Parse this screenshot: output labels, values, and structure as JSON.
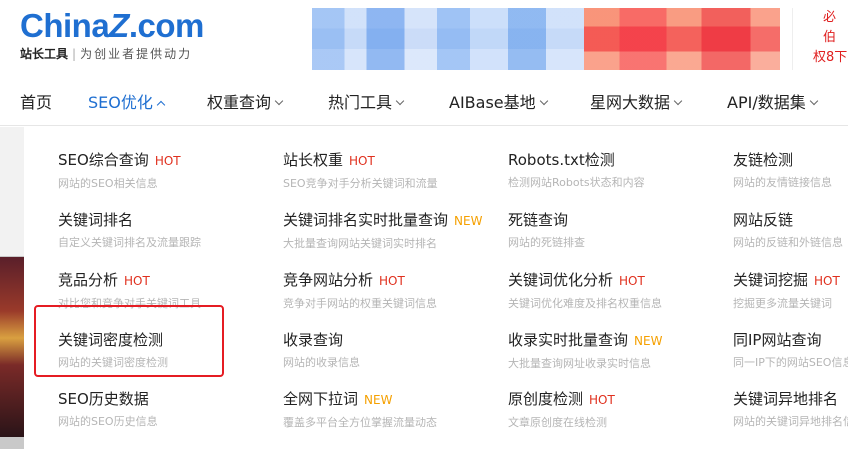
{
  "brand": {
    "logo_text_main": "China",
    "logo_text_z": "Z",
    "logo_text_tail": ".com",
    "sub_title": "站长工具",
    "separator": "|",
    "slogan": "为创业者提供动力",
    "side_note_line1": "必伯",
    "side_note_line2": "权8下"
  },
  "nav": {
    "items": [
      {
        "label": "首页",
        "has_chevron": false,
        "active": false
      },
      {
        "label": "SEO优化",
        "has_chevron": true,
        "active": true
      },
      {
        "label": "权重查询",
        "has_chevron": true,
        "active": false
      },
      {
        "label": "热门工具",
        "has_chevron": true,
        "active": false
      },
      {
        "label": "AIBase基地",
        "has_chevron": true,
        "active": false
      },
      {
        "label": "星网大数据",
        "has_chevron": true,
        "active": false
      },
      {
        "label": "API/数据集",
        "has_chevron": true,
        "active": false
      }
    ]
  },
  "menu": {
    "columns": [
      [
        {
          "title": "SEO综合查询",
          "badge": "HOT",
          "desc": "网站的SEO相关信息"
        },
        {
          "title": "关键词排名",
          "badge": "",
          "desc": "自定义关键词排名及流量跟踪"
        },
        {
          "title": "竞品分析",
          "badge": "HOT",
          "desc": "对比您和竞争对手关键词工具"
        },
        {
          "title": "关键词密度检测",
          "badge": "",
          "desc": "网站的关键词密度检测"
        },
        {
          "title": "SEO历史数据",
          "badge": "",
          "desc": "网站的SEO历史信息"
        }
      ],
      [
        {
          "title": "站长权重",
          "badge": "HOT",
          "desc": "SEO竞争对手分析关键词和流量"
        },
        {
          "title": "关键词排名实时批量查询",
          "badge": "NEW",
          "desc": "大批量查询网站关键词实时排名"
        },
        {
          "title": "竞争网站分析",
          "badge": "HOT",
          "desc": "竞争对手网站的权重关键词信息"
        },
        {
          "title": "收录查询",
          "badge": "",
          "desc": "网站的收录信息"
        },
        {
          "title": "全网下拉词",
          "badge": "NEW",
          "desc": "覆盖多平台全方位掌握流量动态"
        }
      ],
      [
        {
          "title": "Robots.txt检测",
          "badge": "",
          "desc": "检测网站Robots状态和内容"
        },
        {
          "title": "死链查询",
          "badge": "",
          "desc": "网站的死链排查"
        },
        {
          "title": "关键词优化分析",
          "badge": "HOT",
          "desc": "关键词优化难度及排名权重信息"
        },
        {
          "title": "收录实时批量查询",
          "badge": "NEW",
          "desc": "大批量查询网址收录实时信息"
        },
        {
          "title": "原创度检测",
          "badge": "HOT",
          "desc": "文章原创度在线检测"
        }
      ],
      [
        {
          "title": "友链检测",
          "badge": "",
          "desc": "网站的友情链接信息"
        },
        {
          "title": "网站反链",
          "badge": "",
          "desc": "网站的反链和外链信息"
        },
        {
          "title": "关键词挖掘",
          "badge": "HOT",
          "desc": "挖掘更多流量关键词"
        },
        {
          "title": "同IP网站查询",
          "badge": "",
          "desc": "同一IP下的网站SEO信息"
        },
        {
          "title": "关键词异地排名",
          "badge": "",
          "desc": "网站的关键词异地排名信息"
        }
      ]
    ]
  },
  "colors": {
    "accent": "#1f6fd1",
    "hot": "#e0301e",
    "new": "#f5a000",
    "highlight_border": "#e51c23"
  }
}
